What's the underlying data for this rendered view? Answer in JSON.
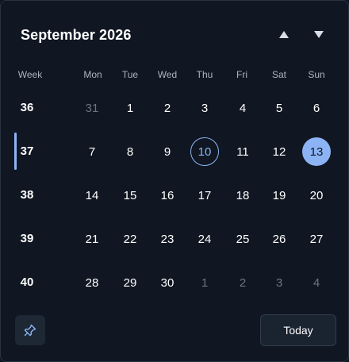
{
  "header": {
    "title": "September 2026"
  },
  "icons": {
    "prev": "triangle-up-icon",
    "next": "triangle-down-icon",
    "pin": "pin-icon"
  },
  "accent_color": "#8cb4f5",
  "weekday_header": [
    "Week",
    "Mon",
    "Tue",
    "Wed",
    "Thu",
    "Fri",
    "Sat",
    "Sun"
  ],
  "weeks": [
    {
      "num": "36",
      "days": [
        {
          "d": "31",
          "muted": true
        },
        {
          "d": "1"
        },
        {
          "d": "2"
        },
        {
          "d": "3"
        },
        {
          "d": "4"
        },
        {
          "d": "5"
        },
        {
          "d": "6"
        }
      ]
    },
    {
      "num": "37",
      "current": true,
      "days": [
        {
          "d": "7"
        },
        {
          "d": "8"
        },
        {
          "d": "9"
        },
        {
          "d": "10",
          "today": true
        },
        {
          "d": "11"
        },
        {
          "d": "12"
        },
        {
          "d": "13",
          "selected": true
        }
      ]
    },
    {
      "num": "38",
      "days": [
        {
          "d": "14"
        },
        {
          "d": "15"
        },
        {
          "d": "16"
        },
        {
          "d": "17"
        },
        {
          "d": "18"
        },
        {
          "d": "19"
        },
        {
          "d": "20"
        }
      ]
    },
    {
      "num": "39",
      "days": [
        {
          "d": "21"
        },
        {
          "d": "22"
        },
        {
          "d": "23"
        },
        {
          "d": "24"
        },
        {
          "d": "25"
        },
        {
          "d": "26"
        },
        {
          "d": "27"
        }
      ]
    },
    {
      "num": "40",
      "days": [
        {
          "d": "28"
        },
        {
          "d": "29"
        },
        {
          "d": "30"
        },
        {
          "d": "1",
          "muted": true
        },
        {
          "d": "2",
          "muted": true
        },
        {
          "d": "3",
          "muted": true
        },
        {
          "d": "4",
          "muted": true
        }
      ]
    }
  ],
  "footer": {
    "today_label": "Today"
  }
}
